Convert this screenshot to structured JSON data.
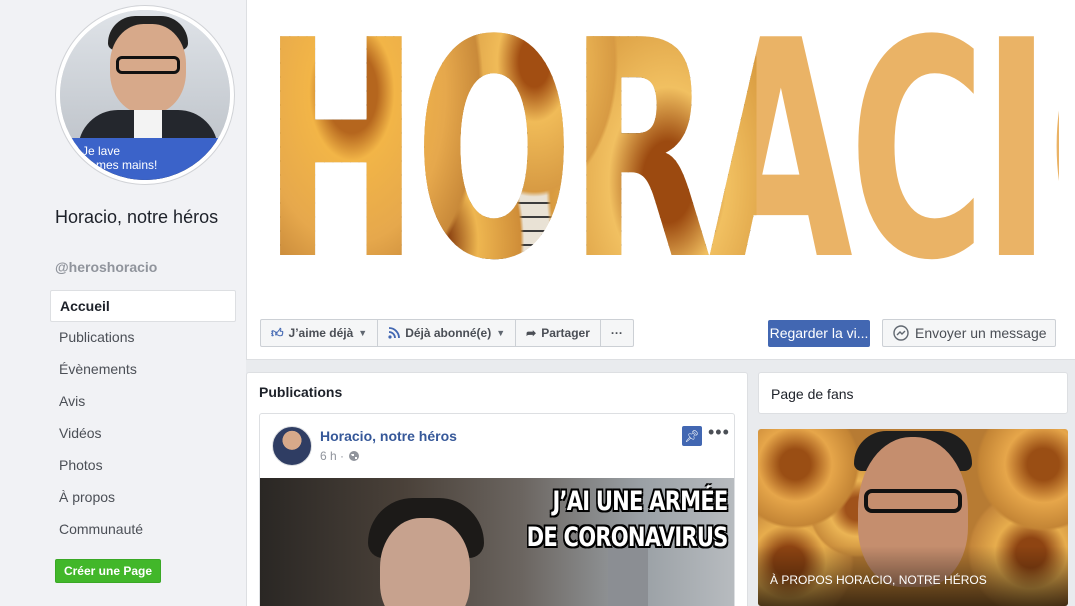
{
  "profile": {
    "avatar_caption_line1": "Je lave",
    "avatar_caption_line2": "mes mains!",
    "name": "Horacio, notre héros",
    "handle": "@heroshoracio"
  },
  "nav": {
    "items": [
      {
        "label": "Accueil",
        "active": true
      },
      {
        "label": "Publications"
      },
      {
        "label": "Évènements"
      },
      {
        "label": "Avis"
      },
      {
        "label": "Vidéos"
      },
      {
        "label": "Photos"
      },
      {
        "label": "À propos"
      },
      {
        "label": "Communauté"
      }
    ],
    "create_page": "Créer une Page"
  },
  "cover": {
    "text": "HORACIO"
  },
  "actions": {
    "like": "J’aime déjà",
    "follow": "Déjà abonné(e)",
    "share": "Partager",
    "more": "···",
    "watch": "Regarder la vi...",
    "message": "Envoyer un message"
  },
  "publications": {
    "title": "Publications",
    "post": {
      "author": "Horacio, notre héros",
      "time": "6 h ·",
      "more": "•••",
      "meme_line1": "J’AI UNE ARMÉE",
      "meme_line2": "DE CORONAVIRUS"
    }
  },
  "fans": {
    "title": "Page de fans",
    "about_label": "À PROPOS HORACIO, NOTRE HÉROS"
  },
  "colors": {
    "accent": "#4267b2",
    "link": "#365899",
    "green": "#42b72a",
    "background": "#e9ebee"
  },
  "icons": [
    "like-thumb-icon",
    "rss-icon",
    "share-arrow-icon",
    "messenger-icon",
    "pin-icon",
    "globe-icon",
    "caret-down-icon"
  ]
}
